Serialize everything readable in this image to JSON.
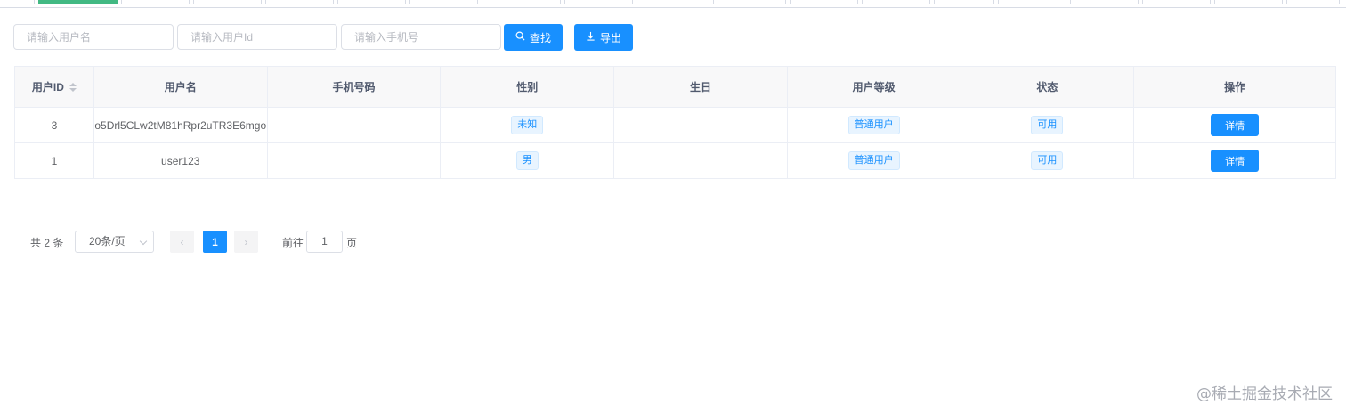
{
  "tabs": [
    {
      "label": "",
      "active": false
    },
    {
      "label": "",
      "active": true
    },
    {
      "label": "",
      "active": false
    },
    {
      "label": "",
      "active": false
    },
    {
      "label": "",
      "active": false
    },
    {
      "label": "",
      "active": false
    },
    {
      "label": "",
      "active": false
    },
    {
      "label": "",
      "active": false
    },
    {
      "label": "",
      "active": false
    },
    {
      "label": "",
      "active": false
    },
    {
      "label": "",
      "active": false
    },
    {
      "label": "",
      "active": false
    },
    {
      "label": "",
      "active": false
    },
    {
      "label": "",
      "active": false
    },
    {
      "label": "",
      "active": false
    },
    {
      "label": "",
      "active": false
    },
    {
      "label": "",
      "active": false
    },
    {
      "label": "",
      "active": false
    },
    {
      "label": "",
      "active": false
    }
  ],
  "search": {
    "username_placeholder": "请输入用户名",
    "username_value": "",
    "userid_placeholder": "请输入用户Id",
    "userid_value": "",
    "phone_placeholder": "请输入手机号",
    "phone_value": "",
    "search_label": "查找",
    "search_icon": "search-icon",
    "export_label": "导出",
    "export_icon": "download-icon"
  },
  "table": {
    "headers": {
      "id": "用户ID",
      "username": "用户名",
      "phone": "手机号码",
      "gender": "性别",
      "birthday": "生日",
      "level": "用户等级",
      "status": "状态",
      "actions": "操作"
    },
    "rows": [
      {
        "id": "3",
        "username": "o5Drl5CLw2tM81hRpr2uTR3E6mgo",
        "phone": "",
        "gender": "未知",
        "birthday": "",
        "level": "普通用户",
        "status": "可用",
        "action": "详情"
      },
      {
        "id": "1",
        "username": "user123",
        "phone": "",
        "gender": "男",
        "birthday": "",
        "level": "普通用户",
        "status": "可用",
        "action": "详情"
      }
    ]
  },
  "pagination": {
    "total_text": "共 2 条",
    "page_size": "20条/页",
    "current_page": "1",
    "goto_label": "前往",
    "goto_value": "1",
    "page_suffix": "页"
  },
  "watermark": "@稀土掘金技术社区",
  "colors": {
    "primary": "#1890ff",
    "active_tab": "#42b983",
    "tag_bg": "#e8f4ff"
  }
}
